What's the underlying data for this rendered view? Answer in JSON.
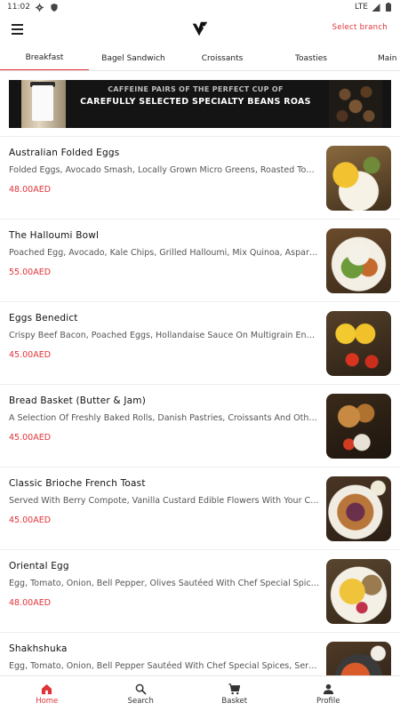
{
  "status_bar": {
    "time": "11:02",
    "network": "LTE"
  },
  "header": {
    "menu_icon": "hamburger-menu-icon",
    "logo_icon": "brand-logo-icon",
    "select_branch": "Select branch"
  },
  "tabs": [
    {
      "label": "Breakfast",
      "active": true
    },
    {
      "label": "Bagel Sandwich",
      "active": false
    },
    {
      "label": "Croissants",
      "active": false
    },
    {
      "label": "Toasties",
      "active": false
    },
    {
      "label": "Main C",
      "active": false
    }
  ],
  "banner": {
    "line1": "CAFFEINE PAIRS OF THE PERFECT CUP OF",
    "line2": "CAREFULLY SELECTED SPECIALTY BEANS ROAS"
  },
  "menu_items": [
    {
      "name": "Australian Folded Eggs",
      "description": "Folded Eggs, Avocado Smash, Locally Grown Micro Greens, Roasted Tomatoes, Sourdough",
      "price": "48.00AED"
    },
    {
      "name": "The Halloumi Bowl",
      "description": "Poached Egg, Avocado, Kale Chips, Grilled Halloumi, Mix Quinoa, Asparagus",
      "price": "55.00AED"
    },
    {
      "name": "Eggs Benedict",
      "description": "Crispy Beef Bacon, Poached Eggs, Hollandaise Sauce On Multigrain English Muffin",
      "price": "45.00AED"
    },
    {
      "name": "Bread Basket (Butter & Jam)",
      "description": "A Selection Of Freshly Baked Rolls, Danish Pastries, Croissants And Other Breads",
      "price": "45.00AED"
    },
    {
      "name": "Classic Brioche French Toast",
      "description": "Served With Berry Compote, Vanilla Custard Edible Flowers With Your Choice",
      "price": "45.00AED"
    },
    {
      "name": "Oriental Egg",
      "description": "Egg, Tomato, Onion, Bell Pepper, Olives Sautéed With Chef Special Spices",
      "price": "48.00AED"
    },
    {
      "name": "Shakhshuka",
      "description": "Egg, Tomato, Onion, Bell Pepper Sautéed With Chef Special Spices, Served With Bread",
      "price": ""
    }
  ],
  "bottom_nav": [
    {
      "label": "Home",
      "icon": "home-icon",
      "active": true
    },
    {
      "label": "Search",
      "icon": "search-icon",
      "active": false
    },
    {
      "label": "Basket",
      "icon": "basket-icon",
      "active": false
    },
    {
      "label": "Profile",
      "icon": "profile-icon",
      "active": false
    }
  ],
  "colors": {
    "accent": "#e0323a",
    "text": "#111111",
    "muted": "#555555"
  }
}
